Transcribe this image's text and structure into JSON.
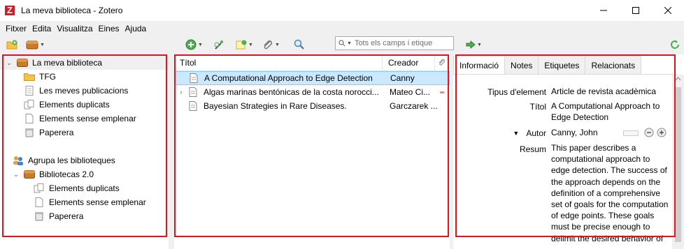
{
  "window": {
    "title": "La meva biblioteca - Zotero",
    "logo_letter": "Z"
  },
  "menu": [
    {
      "label": "Fitxer"
    },
    {
      "label": "Edita"
    },
    {
      "label": "Visualitza"
    },
    {
      "label": "Eines"
    },
    {
      "label": "Ajuda"
    }
  ],
  "toolbar": {
    "search_placeholder": "Tots els camps i etique"
  },
  "left_tree": {
    "library": "La meva biblioteca",
    "items": [
      "TFG",
      "Les meves publicacions",
      "Elements duplicats",
      "Elements sense emplenar",
      "Paperera"
    ],
    "group_header": "Agrupa les biblioteques",
    "group_library": "Bibliotecas 2.0",
    "group_items": [
      "Elements duplicats",
      "Elements sense emplenar",
      "Paperera"
    ]
  },
  "items_list": {
    "col_title": "Títol",
    "col_creator": "Creador",
    "rows": [
      {
        "title": "A Computational Approach to Edge Detection",
        "creator": "Canny"
      },
      {
        "title": "Algas marinas bentónicas de la costa norocci...",
        "creator": "Mateo Ci..."
      },
      {
        "title": "Bayesian Strategies in Rare Diseases.",
        "creator": "Garczarek ..."
      }
    ]
  },
  "info_pane": {
    "tabs": [
      "Informació",
      "Notes",
      "Etiquetes",
      "Relacionats"
    ],
    "fields": {
      "type_label": "Tipus d'element",
      "type_value": "Article de revista acadèmica",
      "title_label": "Títol",
      "title_value": "A Computational Approach to Edge Detection",
      "author_label": "Autor",
      "author_value": "Canny, John",
      "abstract_label": "Resum",
      "abstract_value": "This paper describes a computational approach to edge detection. The success of the approach depends on the definition of a comprehensive set of goals for the computation of edge points. These goals must be precise enough to delimit the desired behavior of"
    }
  },
  "colors": {
    "highlight_box": "#e0141e",
    "selection": "#cce8ff",
    "folder": "#f5c542",
    "library": "#c97a2b"
  }
}
